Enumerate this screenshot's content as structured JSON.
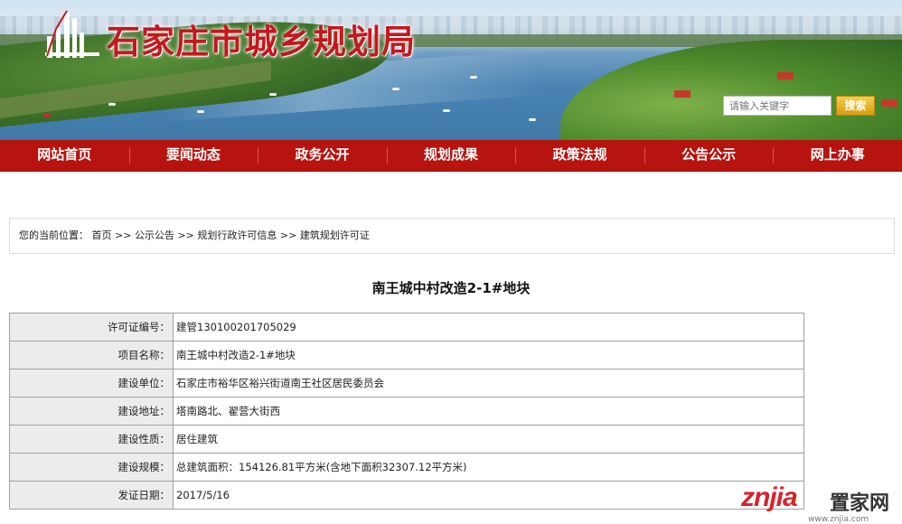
{
  "header": {
    "site_title": "石家庄市城乡规划局",
    "search_placeholder": "请输入关键字",
    "search_button": "搜索"
  },
  "nav": {
    "items": [
      "网站首页",
      "要闻动态",
      "政务公开",
      "规划成果",
      "政策法规",
      "公告公示",
      "网上办事"
    ]
  },
  "breadcrumb": {
    "prefix": "您的当前位置：",
    "items": [
      "首页",
      "公示公告",
      "规划行政许可信息",
      "建筑规划许可证"
    ],
    "separator": ">>"
  },
  "page_title": "南王城中村改造2-1#地块",
  "permit": {
    "rows": [
      {
        "label": "许可证编号：",
        "value": "建管130100201705029"
      },
      {
        "label": "项目名称：",
        "value": "南王城中村改造2-1#地块"
      },
      {
        "label": "建设单位：",
        "value": "石家庄市裕华区裕兴街道南王社区居民委员会"
      },
      {
        "label": "建设地址：",
        "value": "塔南路北、翟营大街西"
      },
      {
        "label": "建设性质：",
        "value": "居住建筑"
      },
      {
        "label": "建设规模：",
        "value": "总建筑面积：154126.81平方米(含地下面积32307.12平方米)"
      },
      {
        "label": "发证日期：",
        "value": "2017/5/16"
      }
    ]
  },
  "watermark": {
    "latin": "znjia",
    "chinese": "置家网",
    "url": "www.znjia.com"
  },
  "colors": {
    "nav_red": "#b7140f",
    "title_red": "#c8161d",
    "search_yellow": "#e0aa1e"
  }
}
